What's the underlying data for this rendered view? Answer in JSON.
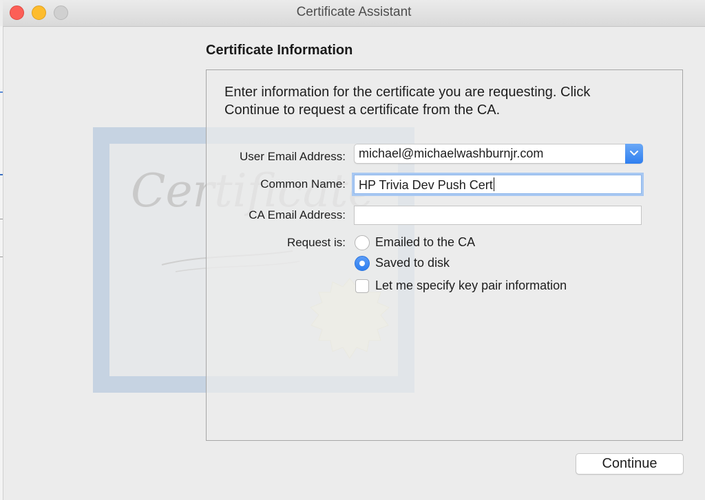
{
  "window": {
    "title": "Certificate Assistant"
  },
  "section": {
    "title": "Certificate Information",
    "intro_line1": "Enter information for the certificate you are requesting. Click",
    "intro_line2": "Continue to request a certificate from the CA."
  },
  "artwork": {
    "watermark_text": "Certificate"
  },
  "form": {
    "user_email_label": "User Email Address:",
    "user_email_value": "michael@michaelwashburnjr.com",
    "common_name_label": "Common Name:",
    "common_name_value": "HP Trivia Dev Push Cert",
    "ca_email_label": "CA Email Address:",
    "ca_email_value": "",
    "request_label": "Request is:",
    "option_emailed": "Emailed to the CA",
    "option_saved": "Saved to disk",
    "selected_option": "Saved to disk",
    "key_pair_label": "Let me specify key pair information",
    "key_pair_checked": false
  },
  "buttons": {
    "continue": "Continue"
  },
  "colors": {
    "accent": "#2f7ff0",
    "close": "#fc5f57",
    "minimize": "#fdbc2e",
    "zoom_inactive": "#d0d0d0"
  },
  "icons": {
    "popup_stepper": "chevron-down-icon",
    "close": "close-icon",
    "minimize": "minimize-icon",
    "zoom": "zoom-icon"
  }
}
